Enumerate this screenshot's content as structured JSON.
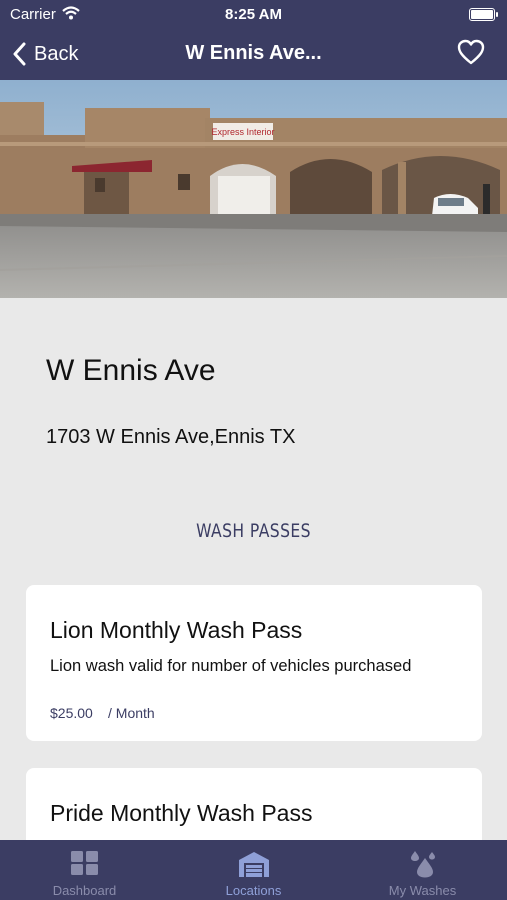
{
  "status_bar": {
    "carrier": "Carrier",
    "time": "8:25 AM"
  },
  "nav": {
    "back_label": "Back",
    "title": "W Ennis Ave..."
  },
  "hero": {
    "sign_text": "Express Interior"
  },
  "location": {
    "name": "W Ennis Ave",
    "address": "1703 W Ennis Ave,Ennis TX"
  },
  "section_title": "WASH PASSES",
  "passes": [
    {
      "name": "Lion Monthly Wash Pass",
      "description": "Lion wash valid for number of vehicles purchased",
      "price": "$25.00",
      "period": "/ Month"
    },
    {
      "name": "Pride Monthly Wash Pass"
    }
  ],
  "tabs": [
    {
      "label": "Dashboard",
      "icon": "dashboard-grid-icon"
    },
    {
      "label": "Locations",
      "icon": "garage-icon"
    },
    {
      "label": "My Washes",
      "icon": "water-drops-icon"
    }
  ],
  "colors": {
    "primary": "#3b3d63",
    "background": "#e9e9e9",
    "tab_active": "#8fa0d8",
    "tab_inactive": "#8a8cab"
  }
}
